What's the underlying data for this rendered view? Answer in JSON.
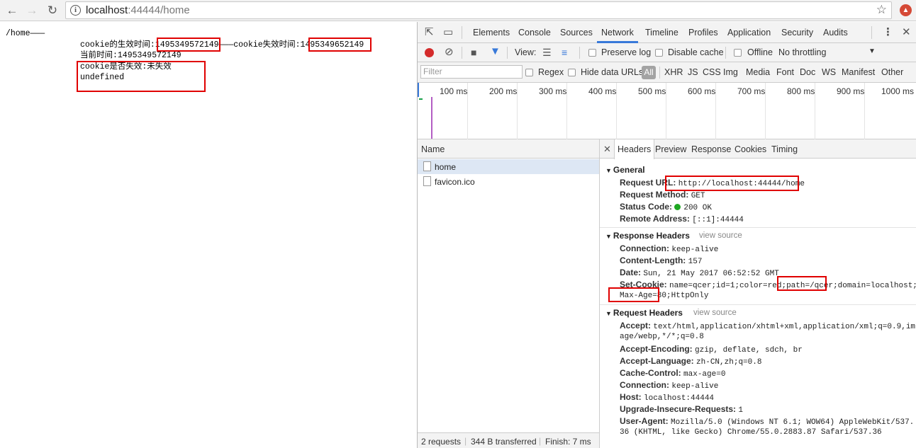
{
  "browser": {
    "url_host": "localhost",
    "url_rest": ":44444/home"
  },
  "page": {
    "title_line": "/home———",
    "line1_prefix": "cookie的生效时间:",
    "effective_time": "1495349572149",
    "line1_middle": "———cookie失效时间:",
    "expire_time": "1495349652149",
    "line2": "当前时间:1495349572149",
    "line3": "cookie是否失效:未失效",
    "line4": "undefined"
  },
  "devtools": {
    "tabs": [
      "Elements",
      "Console",
      "Sources",
      "Network",
      "Timeline",
      "Profiles",
      "Application",
      "Security",
      "Audits"
    ],
    "active_tab": "Network",
    "toolbar": {
      "view_label": "View:",
      "preserve_log": "Preserve log",
      "disable_cache": "Disable cache",
      "offline": "Offline",
      "throttling": "No throttling"
    },
    "filter": {
      "placeholder": "Filter",
      "regex": "Regex",
      "hide_data_urls": "Hide data URLs",
      "all": "All",
      "types": [
        "XHR",
        "JS",
        "CSS",
        "Img",
        "Media",
        "Font",
        "Doc",
        "WS",
        "Manifest",
        "Other"
      ]
    },
    "overview_ticks": [
      "100 ms",
      "200 ms",
      "300 ms",
      "400 ms",
      "500 ms",
      "600 ms",
      "700 ms",
      "800 ms",
      "900 ms",
      "1000 ms"
    ],
    "request_list": {
      "header": "Name",
      "rows": [
        "home",
        "favicon.ico"
      ],
      "status": {
        "requests": "2 requests",
        "transferred": "344 B transferred",
        "finish": "Finish: 7 ms"
      }
    },
    "details": {
      "tabs": [
        "Headers",
        "Preview",
        "Response",
        "Cookies",
        "Timing"
      ],
      "active_tab": "Headers",
      "general": {
        "title": "General",
        "request_url_key": "Request URL:",
        "request_url": "http://localhost:44444/home",
        "request_method_key": "Request Method:",
        "request_method": "GET",
        "status_code_key": "Status Code:",
        "status_code": "200 OK",
        "remote_address_key": "Remote Address:",
        "remote_address": "[::1]:44444"
      },
      "response_headers": {
        "title": "Response Headers",
        "view_source": "view source",
        "connection_key": "Connection:",
        "connection": "keep-alive",
        "content_length_key": "Content-Length:",
        "content_length": "157",
        "date_key": "Date:",
        "date": "Sun, 21 May 2017 06:52:52 GMT",
        "set_cookie_key": "Set-Cookie:",
        "set_cookie_a": "name=qcer;id=1;color=red;",
        "set_cookie_path": "path=/qcer",
        "set_cookie_b": ";domain=localhost;",
        "set_cookie_max_age": "Max-Age=80",
        "set_cookie_c": ";HttpOnly"
      },
      "request_headers": {
        "title": "Request Headers",
        "view_source": "view source",
        "accept_key": "Accept:",
        "accept_a": "text/html,application/xhtml+xml,application/xml;q=0.9,im",
        "accept_b": "age/webp,*/*;q=0.8",
        "accept_encoding_key": "Accept-Encoding:",
        "accept_encoding": "gzip, deflate, sdch, br",
        "accept_language_key": "Accept-Language:",
        "accept_language": "zh-CN,zh;q=0.8",
        "cache_control_key": "Cache-Control:",
        "cache_control": "max-age=0",
        "connection_key": "Connection:",
        "connection": "keep-alive",
        "host_key": "Host:",
        "host": "localhost:44444",
        "upgrade_key": "Upgrade-Insecure-Requests:",
        "upgrade": "1",
        "user_agent_key": "User-Agent:",
        "user_agent_a": "Mozilla/5.0 (Windows NT 6.1; WOW64) AppleWebKit/537.",
        "user_agent_b": "36 (KHTML, like Gecko) Chrome/55.0.2883.87 Safari/537.36"
      }
    }
  },
  "colors": {
    "highlight_box": "#e00000",
    "accent": "#3879d9",
    "record": "#d42b2b",
    "status_ok": "#1fa823"
  },
  "icons": {
    "back": "back-arrow-icon",
    "forward": "forward-arrow-icon",
    "reload": "reload-icon",
    "info": "info-icon",
    "bookmark": "star-icon",
    "extension": "extension-icon"
  }
}
